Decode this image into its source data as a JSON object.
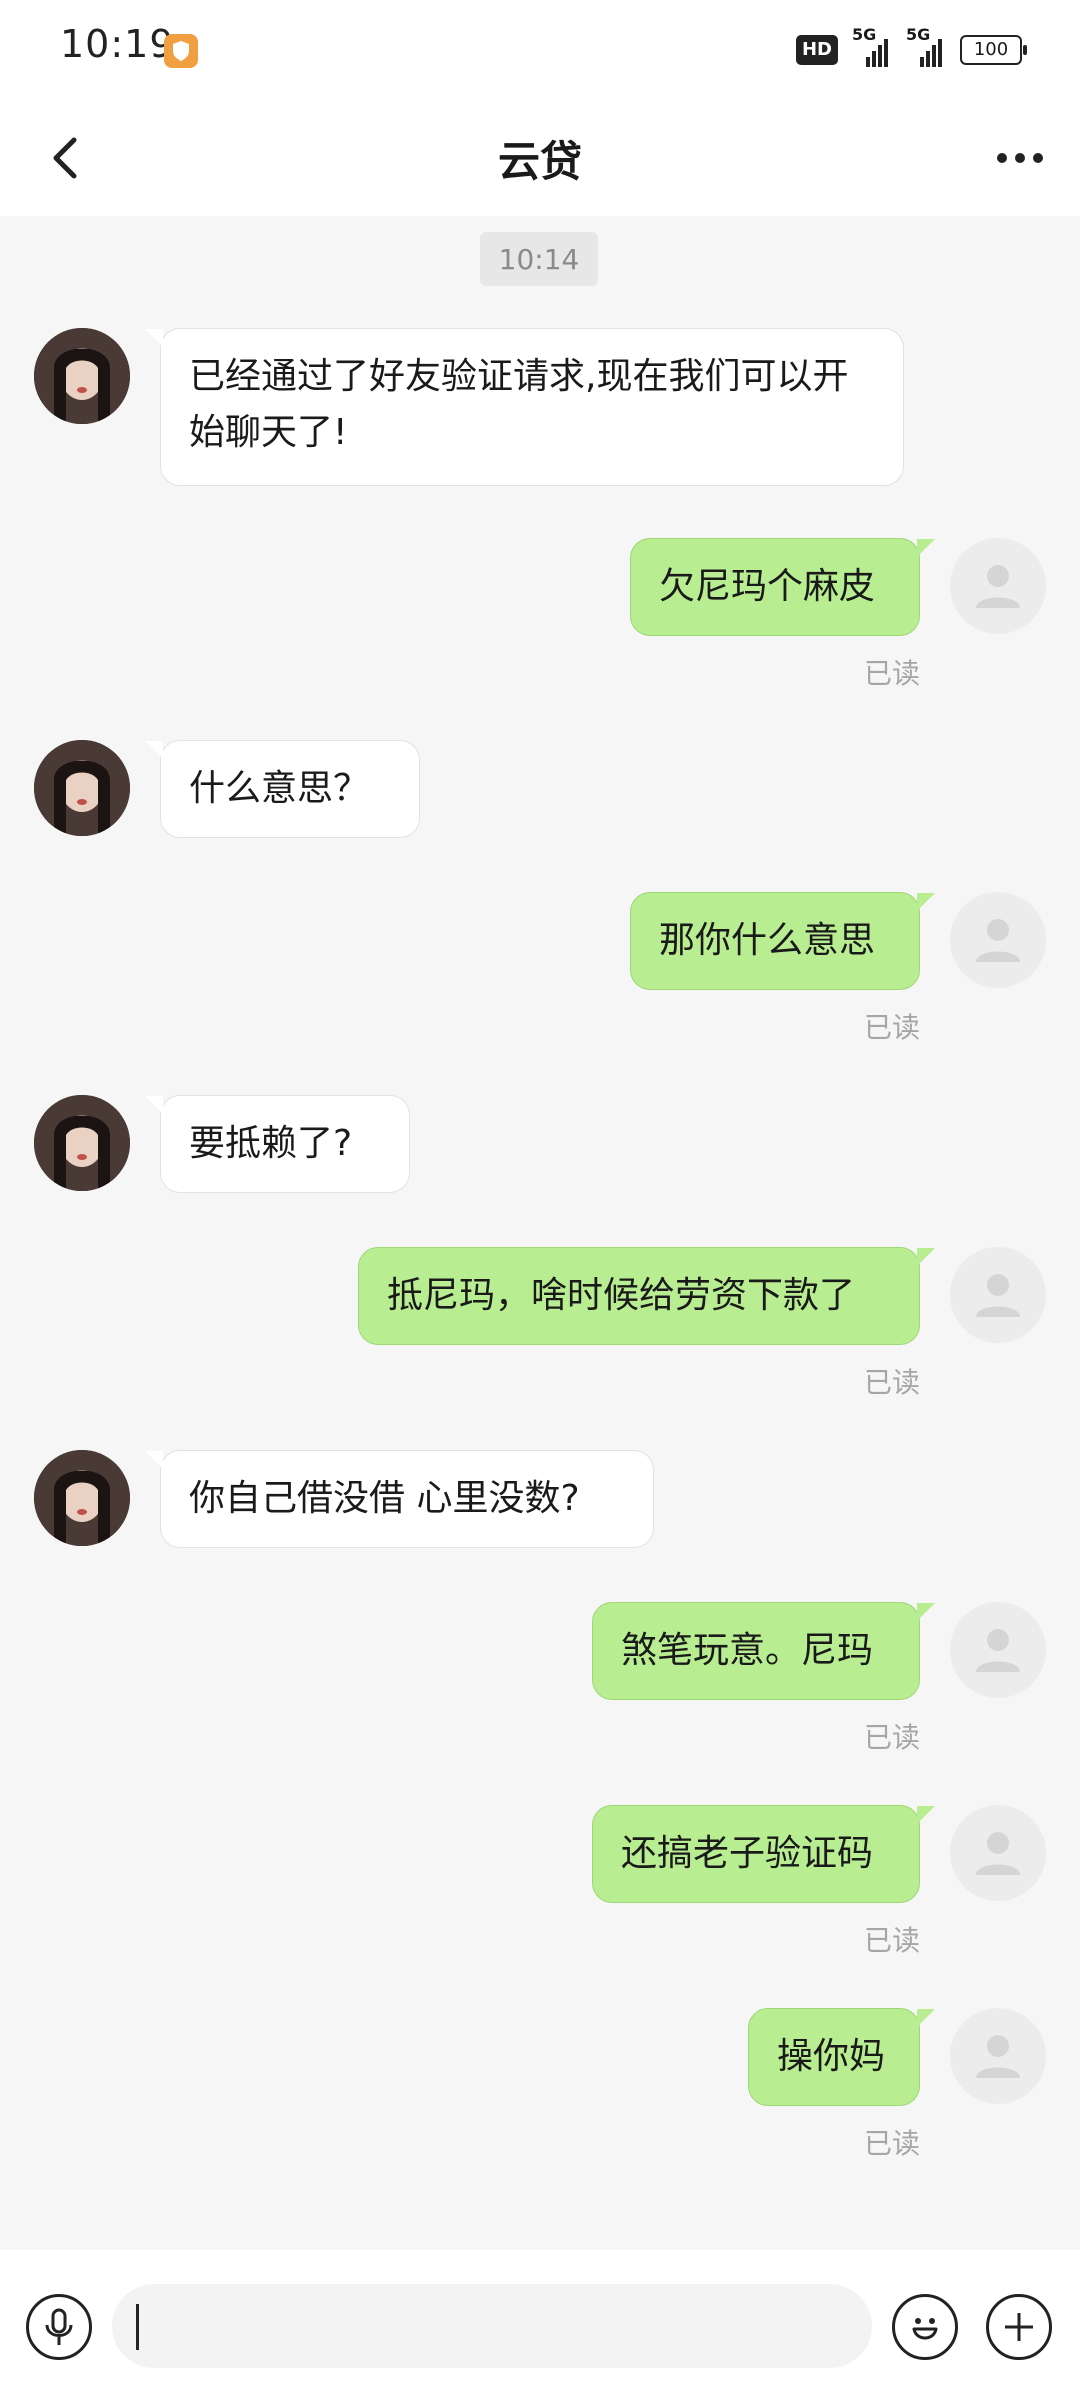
{
  "status_bar": {
    "time": "10:19",
    "hd_label": "HD",
    "signal_1": "5G",
    "signal_2": "5G",
    "battery": "100"
  },
  "header": {
    "title": "云贷",
    "back_icon": "chevron-left-icon",
    "more_icon": "more-horizontal-icon"
  },
  "timestamp": "10:14",
  "read_label": "已读",
  "messages": [
    {
      "side": "in",
      "text": "已经通过了好友验证请求,现在我们可以开始聊天了!"
    },
    {
      "side": "out",
      "text": "欠尼玛个麻皮",
      "status": "已读"
    },
    {
      "side": "in",
      "text": "什么意思？"
    },
    {
      "side": "out",
      "text": "那你什么意思",
      "status": "已读"
    },
    {
      "side": "in",
      "text": "要抵赖了?"
    },
    {
      "side": "out",
      "text": "抵尼玛，啥时候给劳资下款了",
      "status": "已读"
    },
    {
      "side": "in",
      "text": "你自己借没借 心里没数?"
    },
    {
      "side": "out",
      "text": "煞笔玩意。尼玛",
      "status": "已读"
    },
    {
      "side": "out",
      "text": "还搞老子验证码",
      "status": "已读"
    },
    {
      "side": "out",
      "text": "操你妈",
      "status": "已读"
    }
  ],
  "input_bar": {
    "voice_icon": "microphone-icon",
    "emoji_icon": "emoji-icon",
    "add_icon": "plus-icon",
    "input_value": ""
  },
  "colors": {
    "outgoing_bubble": "#b8ee91",
    "incoming_bubble": "#ffffff",
    "background": "#f6f6f6"
  }
}
